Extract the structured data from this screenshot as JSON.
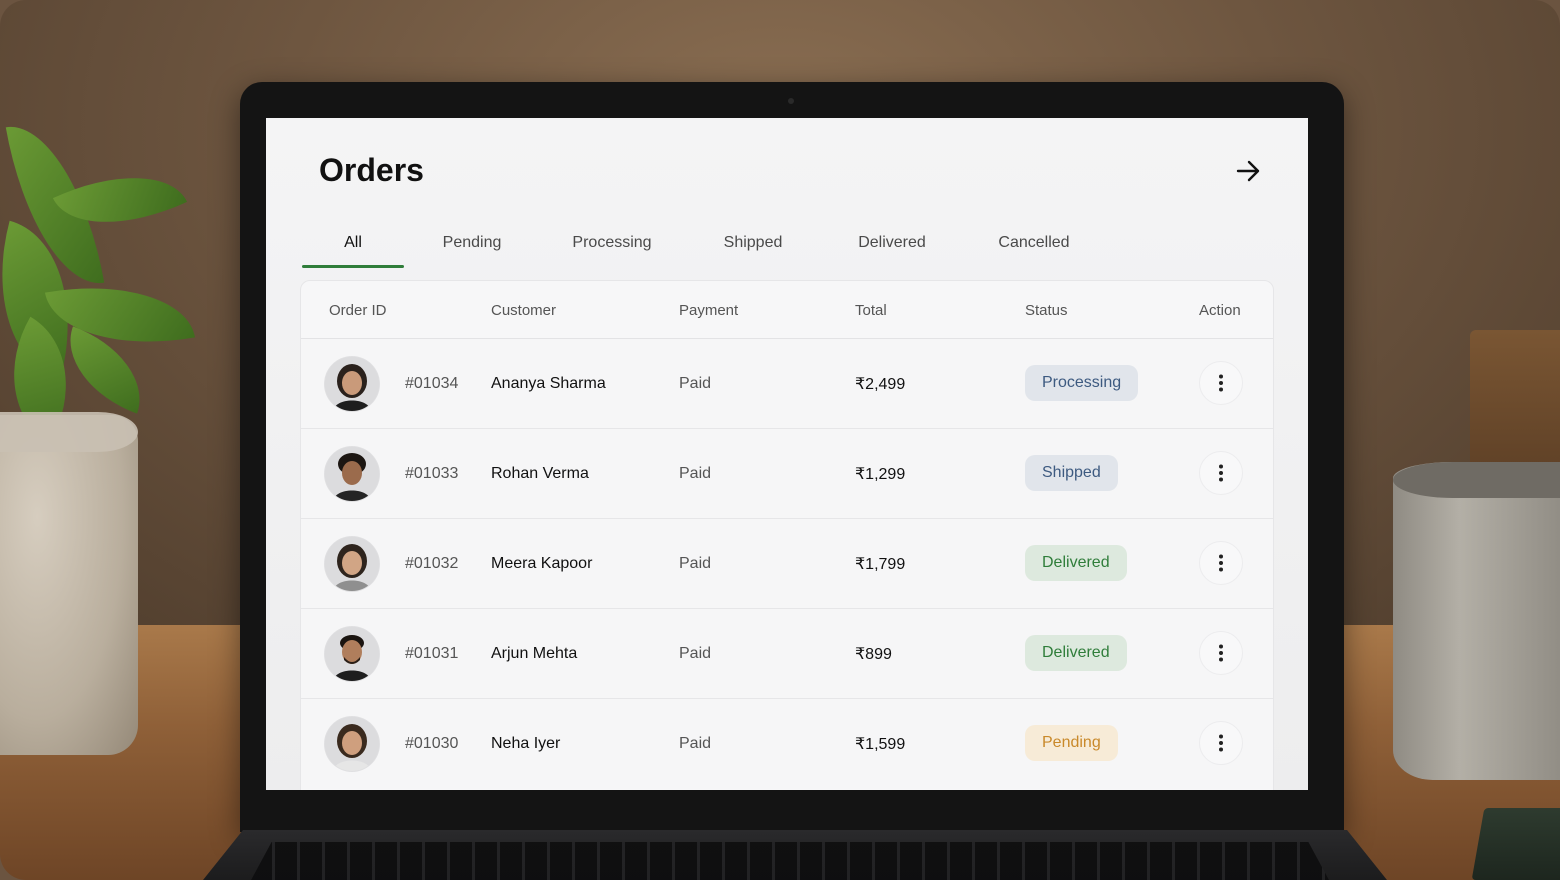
{
  "app": {
    "title": "Orders",
    "header_action_icon": "arrow-right-icon"
  },
  "tabs": [
    {
      "label": "All",
      "active": true
    },
    {
      "label": "Pending",
      "active": false
    },
    {
      "label": "Processing",
      "active": false
    },
    {
      "label": "Shipped",
      "active": false
    },
    {
      "label": "Delivered",
      "active": false
    },
    {
      "label": "Cancelled",
      "active": false
    }
  ],
  "table": {
    "columns": [
      "Order ID",
      "Customer",
      "Payment",
      "Total",
      "Status",
      "Action"
    ],
    "rows": [
      {
        "order_id": "#01034",
        "customer": "Ananya Sharma",
        "payment": "Paid",
        "total": "₹2,499",
        "status": "Processing",
        "status_kind": "processing"
      },
      {
        "order_id": "#01033",
        "customer": "Rohan Verma",
        "payment": "Paid",
        "total": "₹1,299",
        "status": "Shipped",
        "status_kind": "shipped"
      },
      {
        "order_id": "#01032",
        "customer": "Meera Kapoor",
        "payment": "Paid",
        "total": "₹1,799",
        "status": "Delivered",
        "status_kind": "delivered"
      },
      {
        "order_id": "#01031",
        "customer": "Arjun Mehta",
        "payment": "Paid",
        "total": "₹899",
        "status": "Delivered",
        "status_kind": "delivered"
      },
      {
        "order_id": "#01030",
        "customer": "Neha Iyer",
        "payment": "Paid",
        "total": "₹1,599",
        "status": "Pending",
        "status_kind": "pending"
      }
    ]
  },
  "colors": {
    "accent": "#2f7d3a",
    "processing": "#3d5a80",
    "delivered": "#2f7d3a",
    "pending": "#c9892a"
  }
}
